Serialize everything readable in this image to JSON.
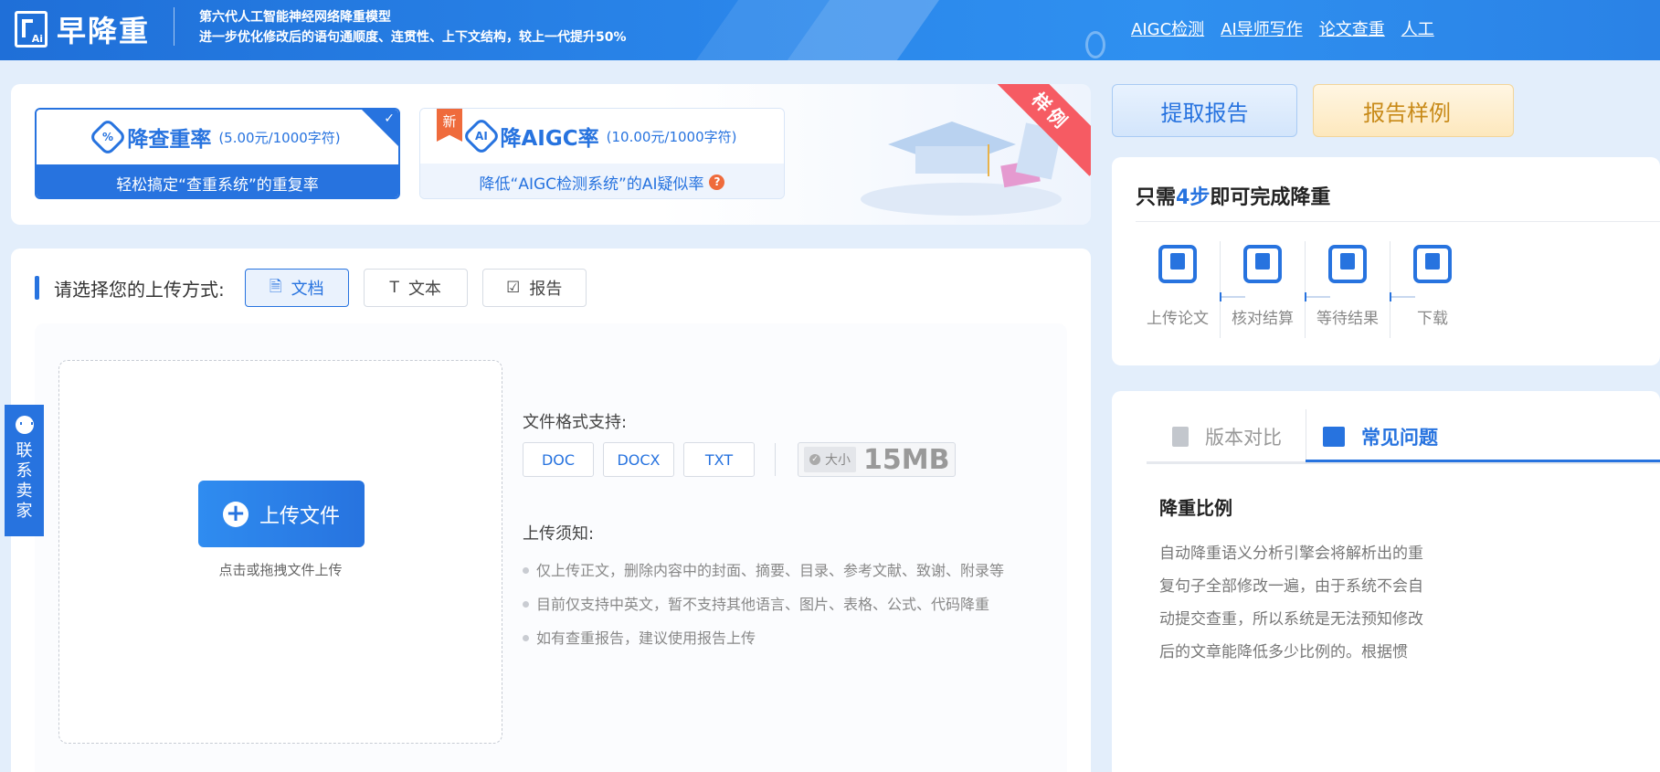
{
  "header": {
    "logo_text": "早降重",
    "logo_mark_text": "Ai",
    "slogan_line1": "第六代人工智能神经网络降重模型",
    "slogan_line2": "进一步优化修改后的语句通顺度、连贯性、上下文结构，较上一代提升50%",
    "nav": [
      "AIGC检测",
      "AI导师写作",
      "论文查重",
      "人工"
    ]
  },
  "modes": [
    {
      "title": "降查重率",
      "price": "(5.00元/1000字符)",
      "desc": "轻松搞定“查重系统”的重复率",
      "icon": "percent-shield-icon",
      "selected": true
    },
    {
      "title": "降AIGC率",
      "price": "(10.00元/1000字符)",
      "desc": "降低“AIGC检测系统”的AI疑似率",
      "icon": "ai-shield-icon",
      "badge": "新"
    }
  ],
  "ribbon": "样例",
  "upload": {
    "method_label": "请选择您的上传方式:",
    "methods": [
      {
        "label": "文档",
        "icon": "document-icon",
        "active": true
      },
      {
        "label": "文本",
        "icon": "text-icon"
      },
      {
        "label": "报告",
        "icon": "clipboard-check-icon"
      }
    ],
    "upload_button": "上传文件",
    "drop_hint": "点击或拖拽文件上传",
    "formats_title": "文件格式支持:",
    "formats": [
      "DOC",
      "DOCX",
      "TXT"
    ],
    "size_label": "大小",
    "size_value": "15MB",
    "notice_title": "上传须知:",
    "notices": [
      "仅上传正文，删除内容中的封面、摘要、目录、参考文献、致谢、附录等",
      "目前仅支持中英文，暂不支持其他语言、图片、表格、公式、代码降重",
      "如有查重报告，建议使用报告上传"
    ]
  },
  "contact": {
    "chars": [
      "联",
      "系",
      "卖",
      "家"
    ]
  },
  "right": {
    "extract_report": "提取报告",
    "sample_report": "报告样例",
    "steps_title_pre": "只需",
    "steps_title_num": "4步",
    "steps_title_post": "即可完成降重",
    "steps": [
      "上传论文",
      "核对结算",
      "等待结果",
      "下载"
    ],
    "faq_tabs": [
      "版本对比",
      "常见问题"
    ],
    "faq_heading": "降重比例",
    "faq_lines": [
      "自动降重语义分析引擎会将解析出的重",
      "复句子全部修改一遍，由于系统不会自",
      "动提交查重，所以系统是无法预知修改",
      "后的文章能降低多少比例的。根据惯"
    ]
  },
  "colors": {
    "primary": "#2773df",
    "accent_orange": "#ef6b3c",
    "ribbon_red": "#f65b63",
    "background": "#e3eefb"
  }
}
